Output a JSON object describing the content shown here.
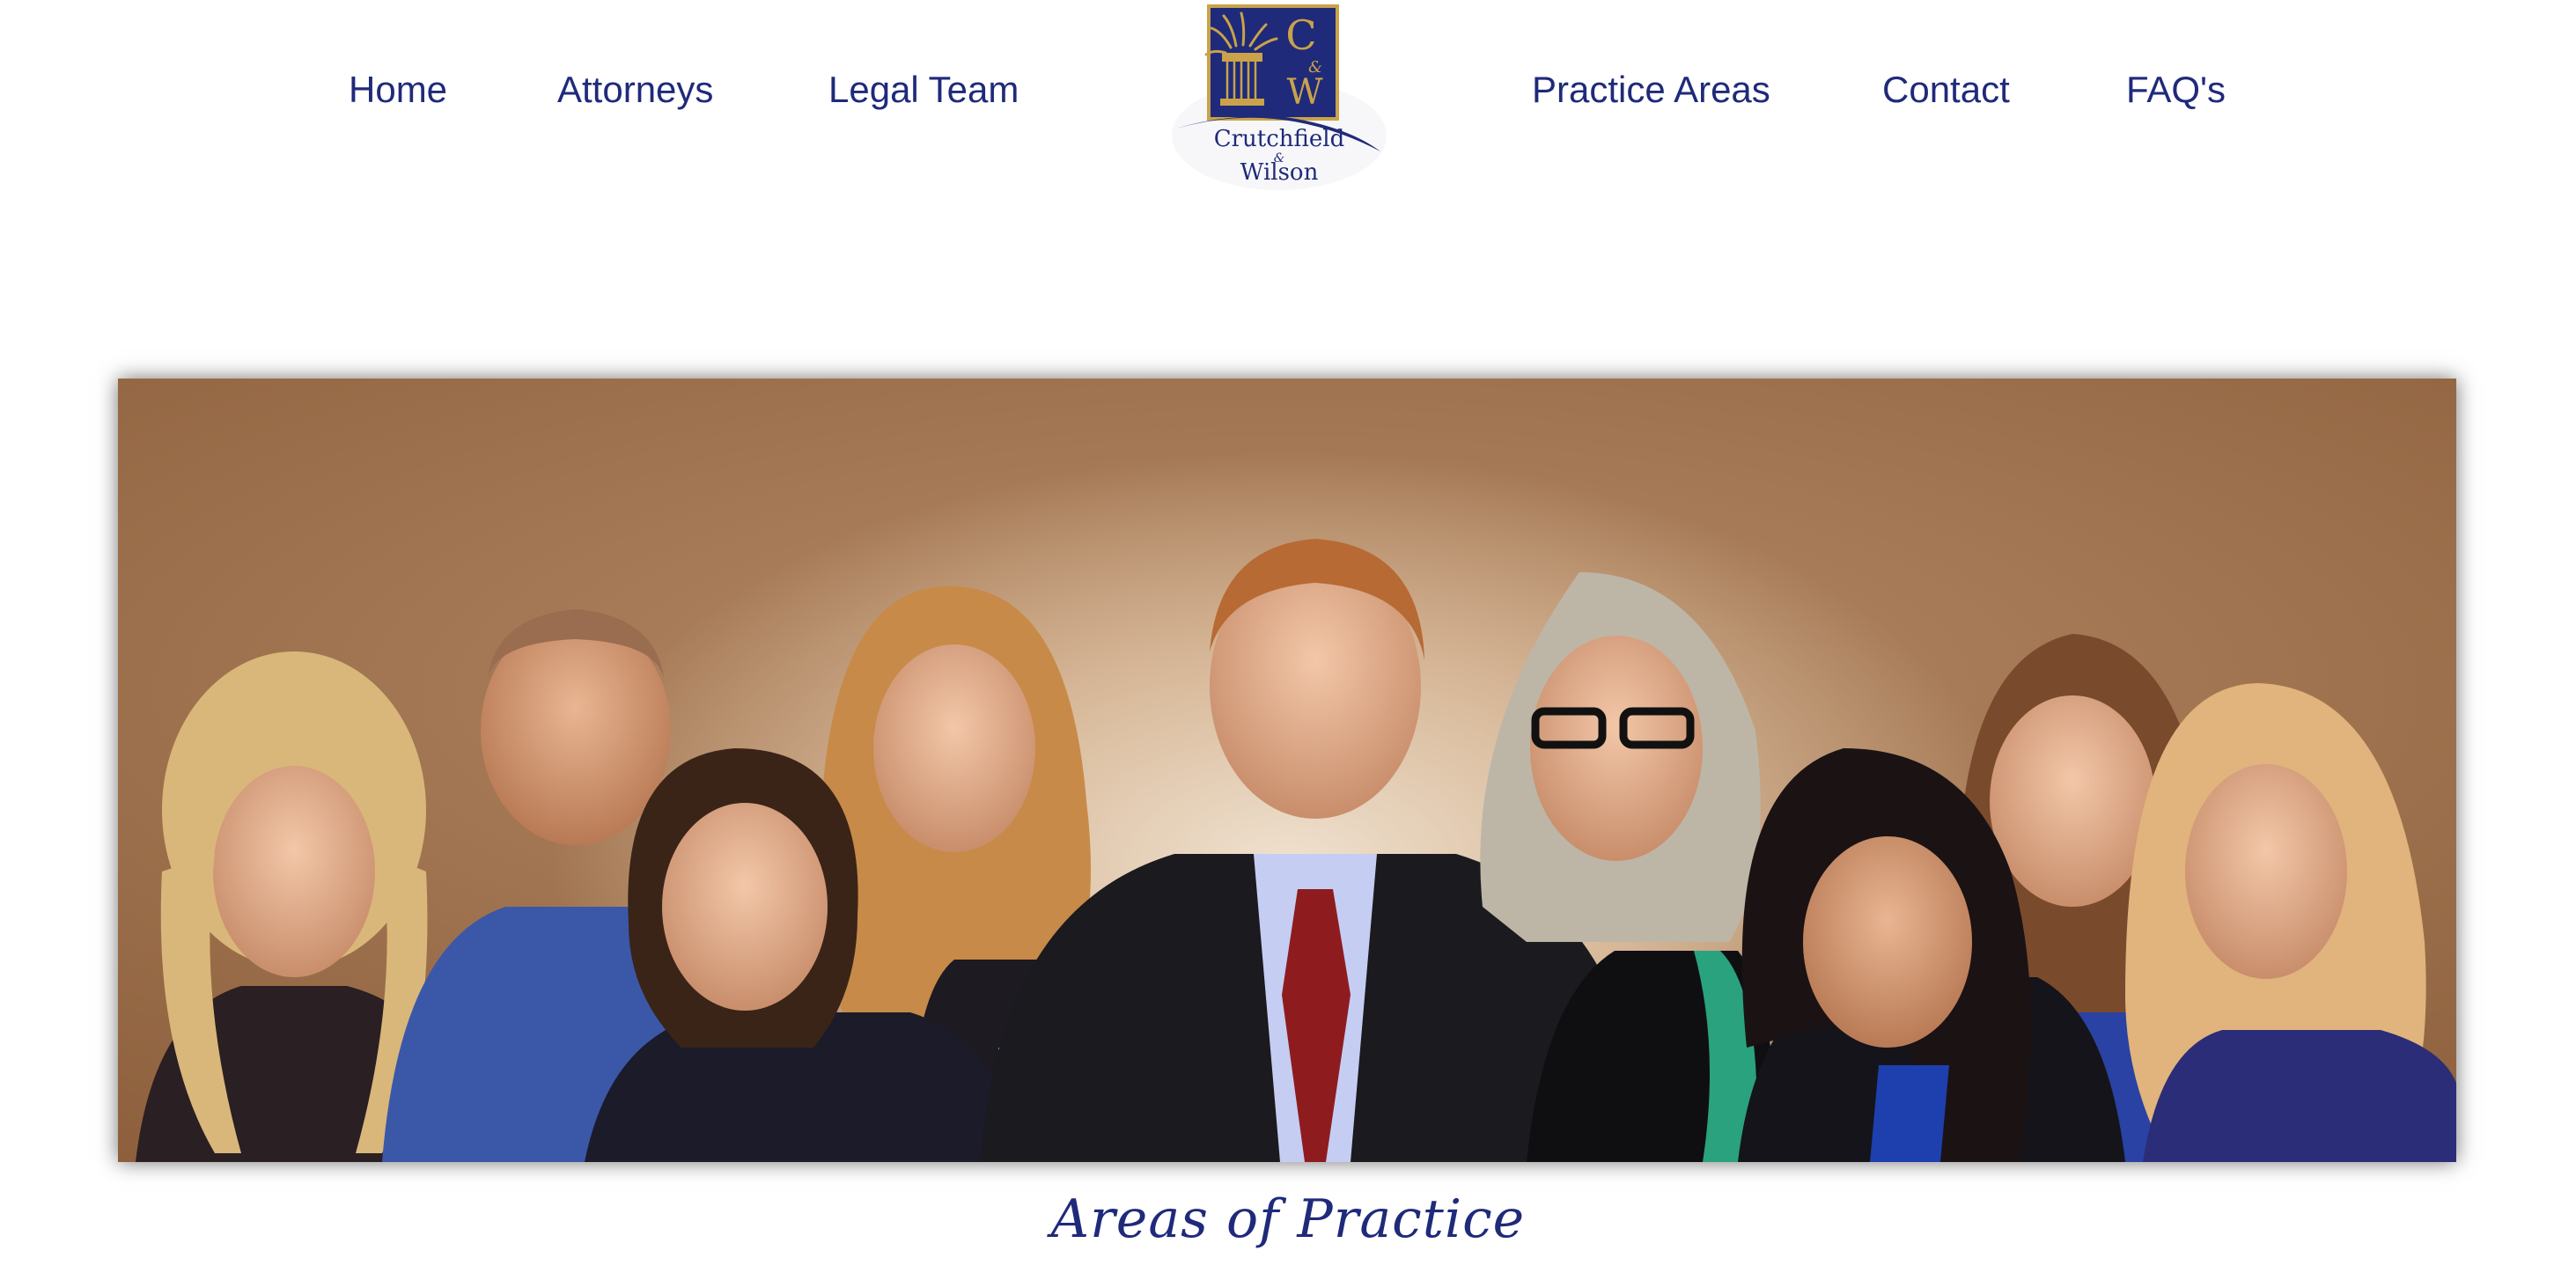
{
  "nav": {
    "left": [
      {
        "label": "Home"
      },
      {
        "label": "Attorneys"
      },
      {
        "label": "Legal Team"
      }
    ],
    "right": [
      {
        "label": "Practice Areas"
      },
      {
        "label": "Contact"
      },
      {
        "label": "FAQ's"
      }
    ]
  },
  "logo": {
    "monogram_top": "C",
    "monogram_amp": "&",
    "monogram_bottom": "W",
    "name_line1": "Crutchfield",
    "name_amp": "&",
    "name_line2": "Wilson",
    "icon": "column-with-plant-icon"
  },
  "hero": {
    "image": "team-group-photo",
    "background_color": "#a97a55"
  },
  "section": {
    "title": "Areas of Practice"
  },
  "colors": {
    "brand_navy": "#1f2a7a",
    "logo_gold": "#c9a24a",
    "background": "#ffffff"
  }
}
